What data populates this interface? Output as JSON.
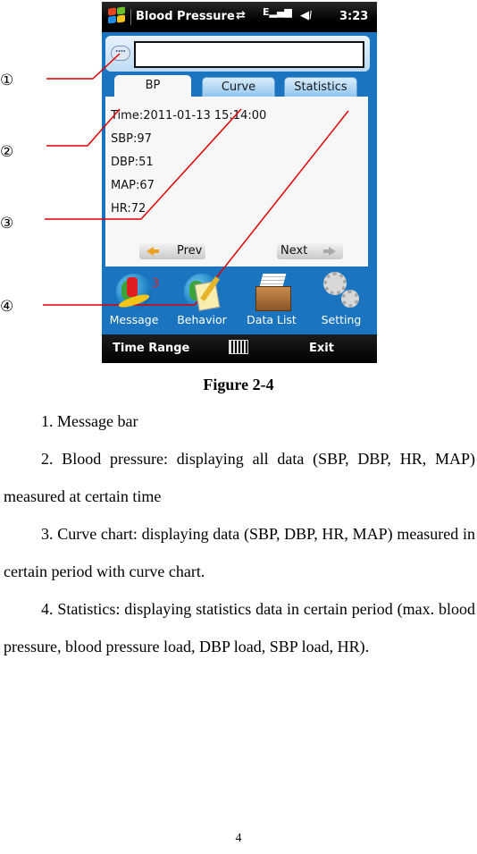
{
  "phone": {
    "status_bar": {
      "app_title": "Blood Pressure",
      "icons": [
        "windows-start-icon",
        "sync-arrows-icon",
        "signal-edge-icon",
        "volume-icon"
      ],
      "time": "3:23"
    },
    "message_bar": {
      "icon": "speech-bubble-icon",
      "value": ""
    },
    "tabs": [
      {
        "label": "BP",
        "active": true
      },
      {
        "label": "Curve",
        "active": false
      },
      {
        "label": "Statistics",
        "active": false
      }
    ],
    "reading": {
      "time": "Time:2011-01-13 15:14:00",
      "sbp": "SBP:97",
      "dbp": "DBP:51",
      "map": "MAP:67",
      "hr": "HR:72"
    },
    "nav": {
      "prev": "Prev",
      "next": "Next"
    },
    "app_icons": [
      {
        "label": "Message",
        "icon": "surfer-globe-icon",
        "badge": "3"
      },
      {
        "label": "Behavior",
        "icon": "pencil-globe-icon"
      },
      {
        "label": "Data List",
        "icon": "file-box-icon"
      },
      {
        "label": "Setting",
        "icon": "gears-icon"
      }
    ],
    "softkeys": {
      "left": "Time Range",
      "center_icon": "keyboard-icon",
      "right": "Exit"
    }
  },
  "callouts": [
    "①",
    "②",
    "③",
    "④"
  ],
  "callout_color": "#e00000",
  "document": {
    "caption": "Figure 2-4",
    "items": [
      "1. Message bar",
      "2. Blood pressure: displaying all data (SBP, DBP, HR, MAP) measured at certain time",
      "3. Curve chart: displaying data (SBP, DBP, HR, MAP) measured in certain period with curve chart.",
      "4. Statistics: displaying statistics data in certain period (max. blood pressure, blood pressure load, DBP load, SBP load, HR)."
    ],
    "page_number": "4"
  }
}
